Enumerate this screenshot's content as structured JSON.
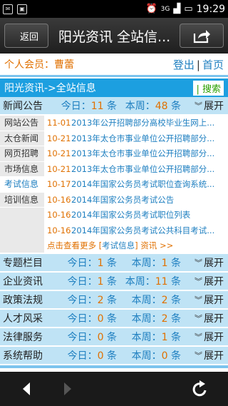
{
  "status": {
    "time": "19:29"
  },
  "header": {
    "back_label": "返回",
    "title": "阳光资讯 全站信..."
  },
  "member": {
    "label": "个人会员：曹蕾",
    "logout": "登出",
    "home": "首页"
  },
  "nav": {
    "breadcrumb": "阳光资讯->全站信息",
    "search": "搜索"
  },
  "labels": {
    "today": "今日：",
    "week": "本周：",
    "count_unit": "条",
    "expand": "展开"
  },
  "news": {
    "name": "新闻公告",
    "today": "11",
    "week": "48"
  },
  "subnav": [
    {
      "label": "网站公告"
    },
    {
      "label": "太仓新闻"
    },
    {
      "label": "网页招聘"
    },
    {
      "label": "市场信息"
    },
    {
      "label": "考试信息"
    },
    {
      "label": "培训信息"
    }
  ],
  "items": [
    {
      "date": "11-01",
      "title": "2013年公开招聘部分高校毕业生网上..."
    },
    {
      "date": "10-21",
      "title": "2013年太仓市事业单位公开招聘部分..."
    },
    {
      "date": "10-21",
      "title": "2013年太仓市事业单位公开招聘部分..."
    },
    {
      "date": "10-21",
      "title": "2013年太仓市事业单位公开招聘部分..."
    },
    {
      "date": "10-17",
      "title": "2014年国家公务员考试职位查询系统..."
    },
    {
      "date": "10-16",
      "title": "2014年国家公务员考试公告"
    },
    {
      "date": "10-16",
      "title": "2014年国家公务员考试职位列表"
    },
    {
      "date": "10-16",
      "title": "2014年国家公务员考试公共科目考试..."
    }
  ],
  "more": {
    "prefix": "点击查看更多 [",
    "category": "考试信息",
    "suffix": "] 资讯 >>"
  },
  "categories": [
    {
      "name": "专题栏目",
      "today": "1",
      "week": "1"
    },
    {
      "name": "企业资讯",
      "today": "1",
      "week": "11"
    },
    {
      "name": "政策法规",
      "today": "2",
      "week": "2"
    },
    {
      "name": "人才风采",
      "today": "0",
      "week": "2"
    },
    {
      "name": "法律服务",
      "today": "0",
      "week": "1"
    },
    {
      "name": "系统帮助",
      "today": "0",
      "week": "0"
    }
  ],
  "colors": {
    "accent": "#1c9fe0",
    "row_bg": "#bfe3f5",
    "number": "#e07000",
    "link": "#1e7fc0"
  }
}
